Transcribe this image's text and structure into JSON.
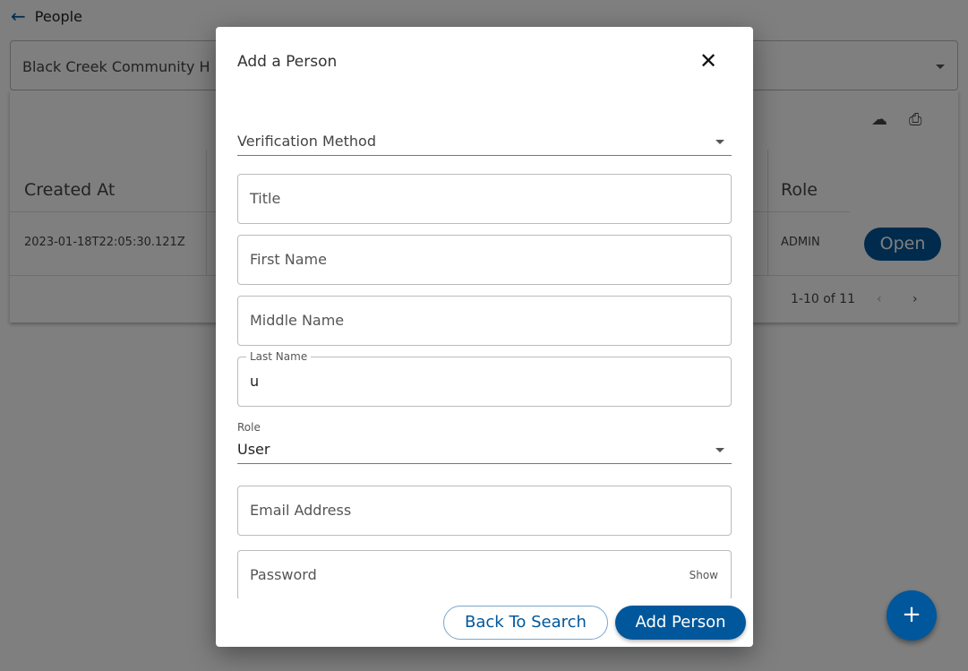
{
  "header": {
    "back_icon": "arrow-left-icon",
    "title": "People"
  },
  "org_select": {
    "value": "Black Creek Community H"
  },
  "table": {
    "columns": [
      "Created At",
      "Role"
    ],
    "rows": [
      {
        "created_at": "2023-01-18T22:05:30.121Z",
        "role": "ADMIN",
        "action": "Open"
      }
    ],
    "pagination": "1-10 of 11",
    "icons": [
      "cloud-download-icon",
      "print-icon"
    ]
  },
  "fab": {
    "label": "+"
  },
  "dialog": {
    "title": "Add a Person",
    "close": "✕",
    "verification_method": {
      "label": "Verification Method",
      "value": ""
    },
    "title_field": {
      "placeholder": "Title",
      "value": ""
    },
    "first_name": {
      "placeholder": "First Name",
      "value": ""
    },
    "middle_name": {
      "placeholder": "Middle Name",
      "value": ""
    },
    "last_name": {
      "label": "Last Name",
      "value": "u"
    },
    "role": {
      "label": "Role",
      "value": "User"
    },
    "email": {
      "placeholder": "Email Address",
      "value": ""
    },
    "password": {
      "placeholder": "Password",
      "toggle": "Show"
    },
    "back_button": "Back To Search",
    "add_button": "Add Person"
  },
  "colors": {
    "primary": "#01579b",
    "overlay": "rgba(0,0,0,0.5)"
  }
}
